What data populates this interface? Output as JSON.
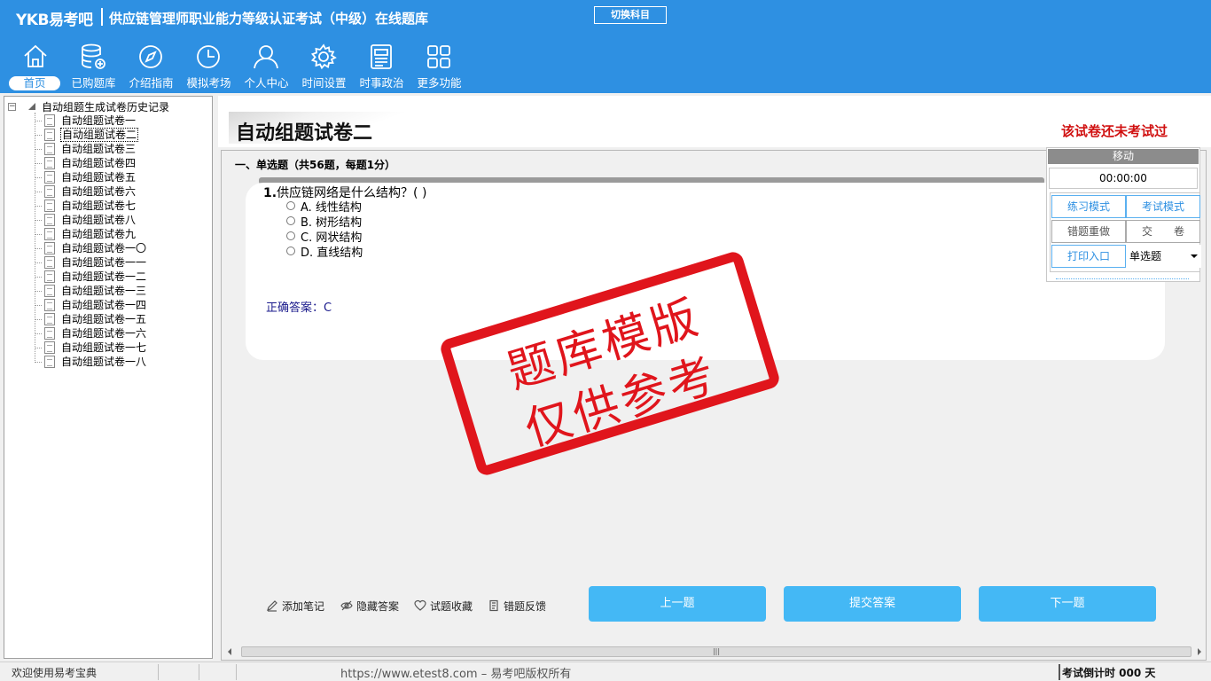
{
  "header": {
    "brand": "YKB易考吧",
    "app_title": "供应链管理师职业能力等级认证考试（中级）在线题库",
    "switch_subject": "切换科目"
  },
  "nav": {
    "items": [
      {
        "label": "首页",
        "icon": "home-icon"
      },
      {
        "label": "已购题库",
        "icon": "database-icon"
      },
      {
        "label": "介绍指南",
        "icon": "compass-icon"
      },
      {
        "label": "模拟考场",
        "icon": "clock-icon"
      },
      {
        "label": "个人中心",
        "icon": "user-icon"
      },
      {
        "label": "时间设置",
        "icon": "gear-icon"
      },
      {
        "label": "时事政治",
        "icon": "newspaper-icon"
      },
      {
        "label": "更多功能",
        "icon": "grid-icon"
      }
    ]
  },
  "tree": {
    "root": "自动组题生成试卷历史记录",
    "items": [
      "自动组题试卷一",
      "自动组题试卷二",
      "自动组题试卷三",
      "自动组题试卷四",
      "自动组题试卷五",
      "自动组题试卷六",
      "自动组题试卷七",
      "自动组题试卷八",
      "自动组题试卷九",
      "自动组题试卷一〇",
      "自动组题试卷一一",
      "自动组题试卷一二",
      "自动组题试卷一三",
      "自动组题试卷一四",
      "自动组题试卷一五",
      "自动组题试卷一六",
      "自动组题试卷一七",
      "自动组题试卷一八"
    ],
    "selected_index": 1
  },
  "paper": {
    "title": "自动组题试卷二",
    "status": "该试卷还未考试过",
    "section": "一、单选题（共56题，每题1分）"
  },
  "question": {
    "number": "1.",
    "text": "供应链网络是什么结构？( )",
    "options": [
      "A. 线性结构",
      "B. 树形结构",
      "C. 网状结构",
      "D. 直线结构"
    ],
    "answer": "正确答案：C"
  },
  "stamp": {
    "line1": "题库模版",
    "line2": "仅供参考"
  },
  "control": {
    "move": "移动",
    "timer": "00:00:00",
    "practice_mode": "练习模式",
    "exam_mode": "考试模式",
    "redo_wrong": "错题重做",
    "submit_paper": "交　　卷",
    "print_entry": "打印入口",
    "question_type": "单选题"
  },
  "actions": {
    "add_note": "添加笔记",
    "hide_answer": "隐藏答案",
    "favorite": "试题收藏",
    "report_error": "错题反馈",
    "prev": "上一题",
    "submit_answer": "提交答案",
    "next": "下一题"
  },
  "statusbar": {
    "welcome": "欢迎使用易考宝典",
    "copyright": "https://www.etest8.com – 易考吧版权所有",
    "countdown": "考试倒计时 000 天"
  },
  "colors": {
    "header_bg": "#2e90e2",
    "button_blue": "#44b8f5",
    "status_red": "#d01010",
    "stamp_red": "#e0151c"
  }
}
